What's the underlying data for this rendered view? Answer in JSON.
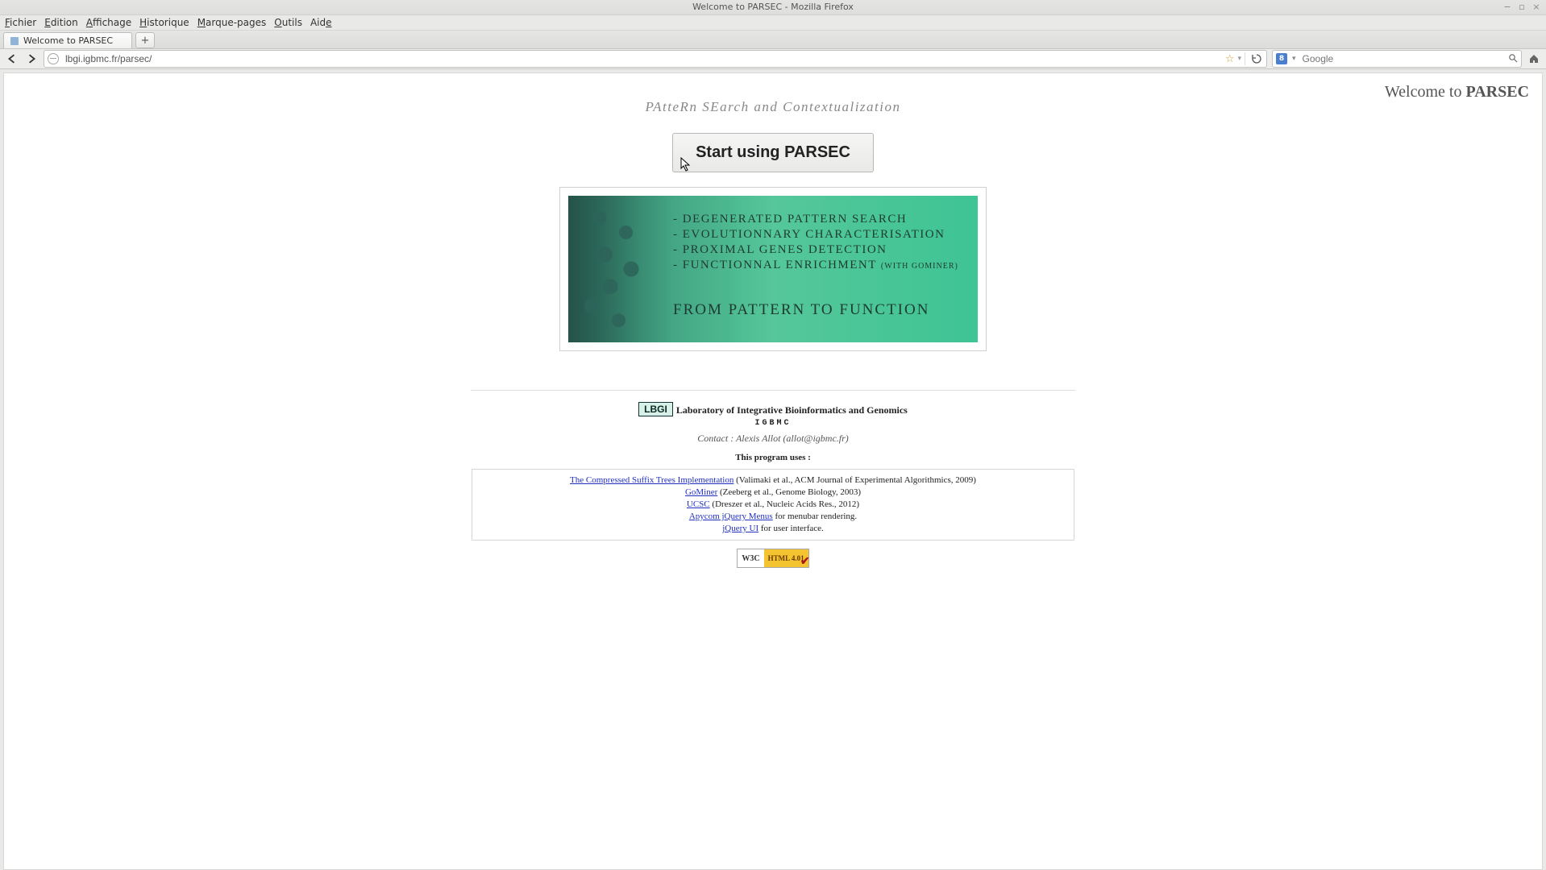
{
  "window": {
    "title": "Welcome to PARSEC - Mozilla Firefox"
  },
  "menubar": {
    "items": [
      "Fichier",
      "Edition",
      "Affichage",
      "Historique",
      "Marque-pages",
      "Outils",
      "Aide"
    ]
  },
  "tab": {
    "title": "Welcome to PARSEC"
  },
  "urlbar": {
    "value": "lbgi.igbmc.fr/parsec/"
  },
  "searchbar": {
    "engine_glyph": "8",
    "placeholder": "Google"
  },
  "page": {
    "welcome_prefix": "Welcome to ",
    "welcome_bold": "PARSEC",
    "tagline": "PAtteRn SEarch and Contextualization",
    "start_button": "Start using PARSEC",
    "banner": {
      "items": [
        "- DEGENERATED PATTERN SEARCH",
        "- EVOLUTIONNARY CHARACTERISATION",
        "- PROXIMAL GENES DETECTION",
        "- FUNCTIONNAL ENRICHMENT"
      ],
      "item_suffix_small": "(WITH GOMINER)",
      "slogan": "FROM PATTERN TO FUNCTION"
    },
    "footer": {
      "lbgi_badge": "LBGI",
      "lbgi_label": "Laboratory of Integrative Bioinformatics and Genomics",
      "igbmc": "IGBMC",
      "contact": "Contact : Alexis Allot (allot@igbmc.fr)",
      "uses_title": "This program uses :",
      "credits": [
        {
          "link": "The Compressed Suffix Trees Implementation",
          "rest": " (Valimaki et al., ACM Journal of Experimental Algorithmics, 2009)"
        },
        {
          "link": "GoMiner",
          "rest": " (Zeeberg et al., Genome Biology, 2003)"
        },
        {
          "link": "UCSC",
          "rest": " (Dreszer et al., Nucleic Acids Res., 2012)"
        },
        {
          "link": "Apycom jQuery Menus",
          "rest": " for menubar rendering."
        },
        {
          "link": "jQuery UI",
          "rest": " for user interface."
        }
      ],
      "w3c_left": "W3C",
      "w3c_right": "HTML 4.01"
    }
  }
}
